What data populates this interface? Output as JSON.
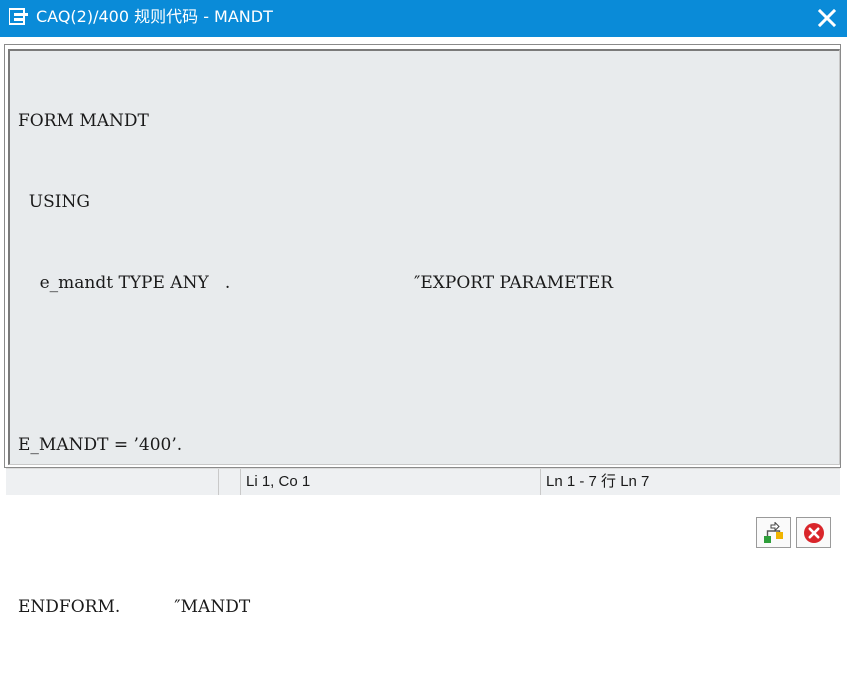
{
  "window": {
    "title": "CAQ(2)/400 规则代码 - MANDT",
    "title_icon": "window-menu-icon",
    "close_icon": "close-icon"
  },
  "editor": {
    "lines": [
      "FORM MANDT",
      "  USING",
      "    e_mandt TYPE ANY   .                                  ″EXPORT PARAMETER",
      "",
      "E_MANDT = ’400’.",
      "",
      "ENDFORM.          ″MANDT"
    ]
  },
  "status_bar": {
    "cursor_position": "Li 1, Co 1",
    "line_range": "Ln 1 - 7 行 Ln 7"
  },
  "footer": {
    "buttons": [
      {
        "name": "transfer-button",
        "icon": "hierarchy-transfer-icon"
      },
      {
        "name": "cancel-button",
        "icon": "cancel-icon"
      }
    ]
  },
  "colors": {
    "titlebar": "#0a8bd8",
    "editor_bg": "#e8ebed",
    "cancel_red": "#d9252a"
  }
}
